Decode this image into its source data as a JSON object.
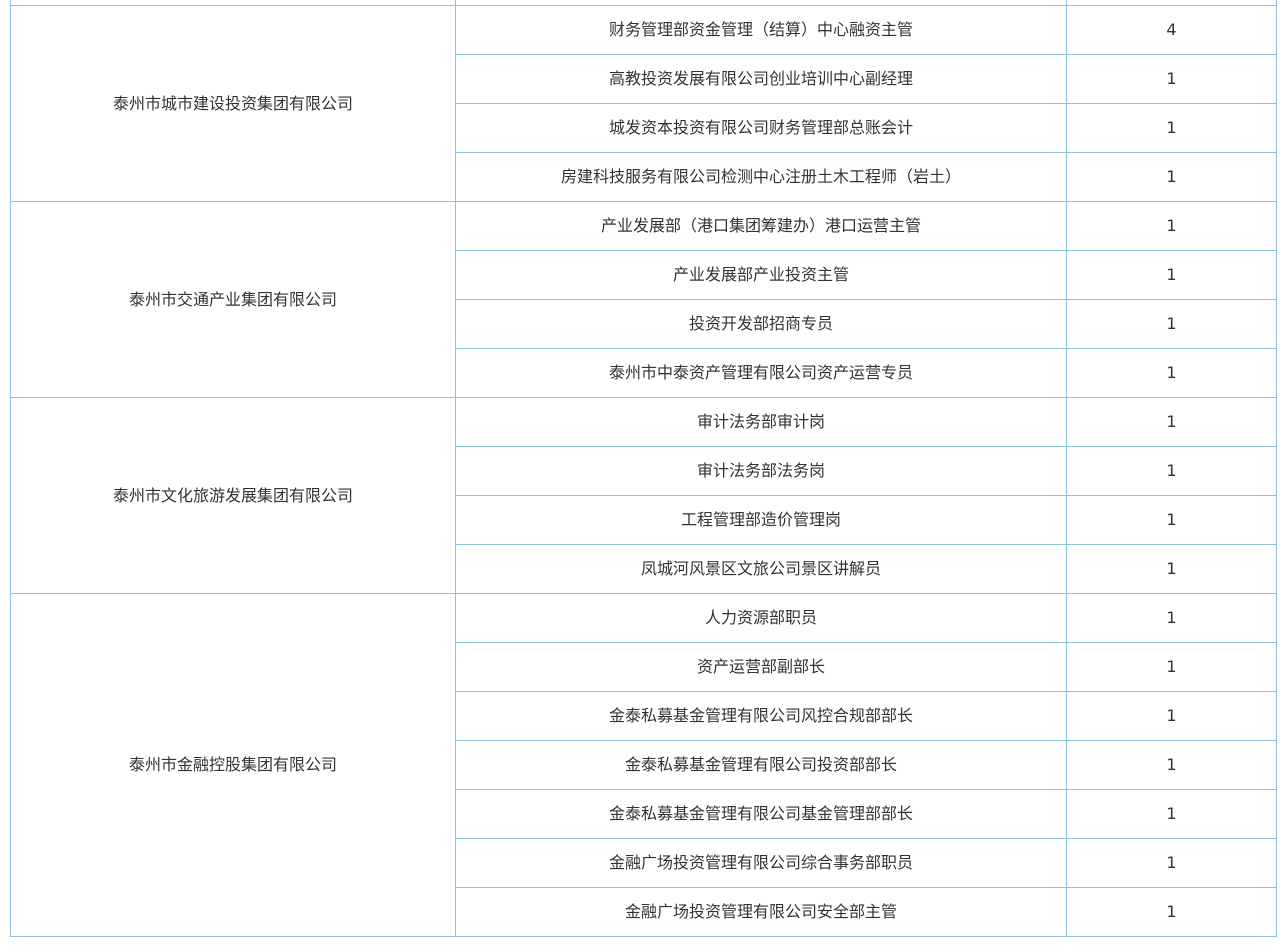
{
  "groups": [
    {
      "company": "泰州市城市建设投资集团有限公司",
      "rows": [
        {
          "position": "财务管理部资金管理（结算）中心融资主管",
          "count": "4"
        },
        {
          "position": "高教投资发展有限公司创业培训中心副经理",
          "count": "1"
        },
        {
          "position": "城发资本投资有限公司财务管理部总账会计",
          "count": "1"
        },
        {
          "position": "房建科技服务有限公司检测中心注册土木工程师（岩土）",
          "count": "1"
        }
      ]
    },
    {
      "company": "泰州市交通产业集团有限公司",
      "rows": [
        {
          "position": "产业发展部（港口集团筹建办）港口运营主管",
          "count": "1"
        },
        {
          "position": "产业发展部产业投资主管",
          "count": "1"
        },
        {
          "position": "投资开发部招商专员",
          "count": "1"
        },
        {
          "position": "泰州市中泰资产管理有限公司资产运营专员",
          "count": "1"
        }
      ]
    },
    {
      "company": "泰州市文化旅游发展集团有限公司",
      "rows": [
        {
          "position": "审计法务部审计岗",
          "count": "1"
        },
        {
          "position": "审计法务部法务岗",
          "count": "1"
        },
        {
          "position": "工程管理部造价管理岗",
          "count": "1"
        },
        {
          "position": "凤城河风景区文旅公司景区讲解员",
          "count": "1"
        }
      ]
    },
    {
      "company": "泰州市金融控股集团有限公司",
      "rows": [
        {
          "position": "人力资源部职员",
          "count": "1"
        },
        {
          "position": "资产运营部副部长",
          "count": "1"
        },
        {
          "position": "金泰私募基金管理有限公司风控合规部部长",
          "count": "1"
        },
        {
          "position": "金泰私募基金管理有限公司投资部部长",
          "count": "1"
        },
        {
          "position": "金泰私募基金管理有限公司基金管理部部长",
          "count": "1"
        },
        {
          "position": "金融广场投资管理有限公司综合事务部职员",
          "count": "1"
        },
        {
          "position": "金融广场投资管理有限公司安全部主管",
          "count": "1"
        }
      ]
    }
  ]
}
